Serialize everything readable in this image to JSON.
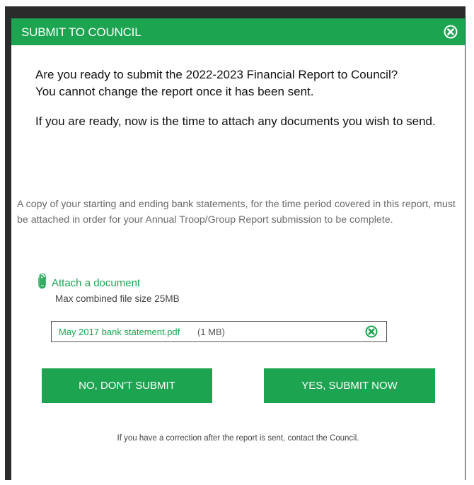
{
  "dialog": {
    "title": "SUBMIT TO COUNCIL",
    "close_icon": "close-circle-icon"
  },
  "intro": {
    "question": "Are you ready to submit the 2022-2023 Financial Report to Council?",
    "warning": "You cannot change the report once it has been sent.",
    "attach_prompt": "If you are ready, now is the time to attach any documents you wish to send."
  },
  "note": "A copy of your starting and ending bank statements, for the time period covered in this report, must be attached in order for your Annual Troop/Group Report submission to be complete.",
  "attachment": {
    "link_label": "Attach a document",
    "link_icon": "paperclip-icon",
    "max_size_text": "Max combined file size 25MB",
    "files": [
      {
        "name": "May 2017 bank statement.pdf",
        "size": "(1 MB)",
        "remove_icon": "remove-circle-icon"
      }
    ]
  },
  "buttons": {
    "no_label": "NO, DON'T SUBMIT",
    "yes_label": "YES, SUBMIT NOW"
  },
  "footer_note": "If you have a correction after the report is sent, contact the Council.",
  "colors": {
    "accent": "#1da451",
    "frame": "#2b2b2b",
    "note_text": "#6a6a6a"
  }
}
